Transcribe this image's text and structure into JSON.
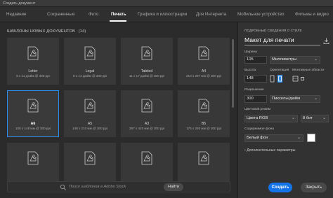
{
  "window": {
    "title": "Создать документ"
  },
  "tabs": [
    {
      "label": "Недавние"
    },
    {
      "label": "Сохраненные"
    },
    {
      "label": "Фото"
    },
    {
      "label": "Печать"
    },
    {
      "label": "Графика и иллюстрации"
    },
    {
      "label": "Для Интернета"
    },
    {
      "label": "Мобильное устройство"
    },
    {
      "label": "Фильмы и видео"
    }
  ],
  "templates": {
    "heading": "ШАБЛОНЫ НОВЫХ ДОКУМЕНТОВ",
    "count": "(14)",
    "tiles": [
      {
        "name": "Letter",
        "size": "8 x 11 дюйм @ 300 ppi"
      },
      {
        "name": "Legal",
        "size": "8 x 14 дюйм @ 300 ppi"
      },
      {
        "name": "Tabloid",
        "size": "11 x 17 дюйм @ 300 ppi"
      },
      {
        "name": "A4",
        "size": "210 x 297 мм @ 300 ppi"
      },
      {
        "name": "A6",
        "size": "105 x 148 мм @ 300 ppi"
      },
      {
        "name": "A5",
        "size": "148 x 210 мм @ 300 ppi"
      },
      {
        "name": "A3",
        "size": "297 x 420 мм @ 300 ppi"
      },
      {
        "name": "B5",
        "size": "176 x 250 мм @ 300 ppi"
      },
      {
        "name": "",
        "size": ""
      },
      {
        "name": "",
        "size": ""
      },
      {
        "name": "",
        "size": ""
      },
      {
        "name": "",
        "size": ""
      }
    ]
  },
  "search": {
    "placeholder": "Поиск шаблонов в Adobe Stock",
    "button": "Найти"
  },
  "details": {
    "heading": "ПОДРОБНЫЕ СВЕДЕНИЯ О СТИЛЕ",
    "doc_name": "Макет для печати",
    "width_label": "Ширина",
    "width_value": "105",
    "units_value": "Миллиметры",
    "height_label": "Высота",
    "height_value": "148",
    "orientation_label": "Ориентация",
    "artboards_label": "Монтажные области",
    "resolution_label": "Разрешение",
    "resolution_value": "300",
    "resolution_units": "Пикселы/дюйм",
    "color_mode_label": "Цветовой режим",
    "color_mode_value": "Цвета RGB",
    "bit_depth_value": "8 бит",
    "background_label": "Содержимое фона",
    "background_value": "Белый фон",
    "advanced_label": "Дополнительные параметры"
  },
  "actions": {
    "create": "Создать",
    "close": "Закрыть"
  },
  "colors": {
    "accent": "#1473e6",
    "selection": "#2d8ceb"
  }
}
